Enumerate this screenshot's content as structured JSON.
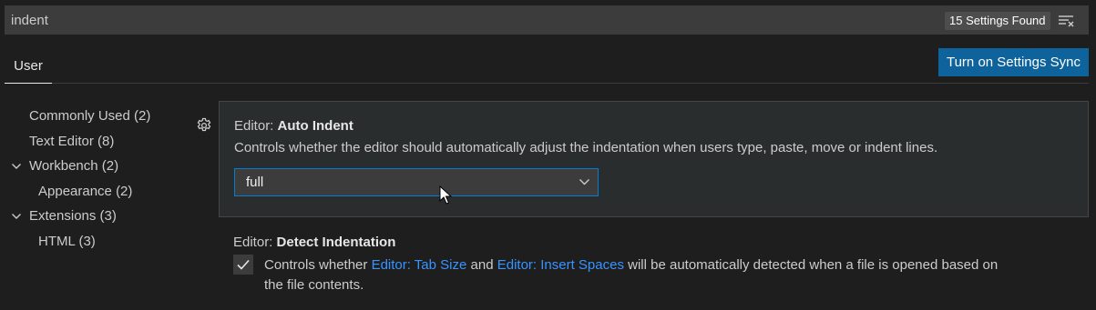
{
  "search": {
    "value": "indent",
    "result_count": "15 Settings Found",
    "filter_icon": "clear-filter-icon"
  },
  "tabs": [
    {
      "label": "User",
      "active": true
    }
  ],
  "sync_button": {
    "label": "Turn on Settings Sync"
  },
  "toc": {
    "items": [
      {
        "label": "Commonly Used (2)",
        "level": 0,
        "expandable": false
      },
      {
        "label": "Text Editor (8)",
        "level": 0,
        "expandable": false
      },
      {
        "label": "Workbench (2)",
        "level": 0,
        "expandable": true,
        "expanded": true
      },
      {
        "label": "Appearance (2)",
        "level": 1,
        "expandable": false
      },
      {
        "label": "Extensions (3)",
        "level": 0,
        "expandable": true,
        "expanded": true
      },
      {
        "label": "HTML (3)",
        "level": 1,
        "expandable": false
      }
    ]
  },
  "settings": [
    {
      "category": "Editor: ",
      "name": "Auto Indent",
      "description": "Controls whether the editor should automatically adjust the indentation when users type, paste, move or indent lines.",
      "value": "full",
      "control": "select",
      "gear_icon": "gear-icon"
    },
    {
      "category": "Editor: ",
      "name": "Detect Indentation",
      "control": "checkbox",
      "checked": true,
      "description": {
        "part1": "Controls whether ",
        "link1": "Editor: Tab Size",
        "part2": " and ",
        "link2": "Editor: Insert Spaces",
        "part3": " will be automatically detected when a file is opened based on",
        "line2": "the file contents."
      }
    }
  ],
  "colors": {
    "background": "#1e1e1e",
    "accent_button": "#0e639c",
    "focus_border": "#007fd4",
    "link": "#3794ff"
  }
}
